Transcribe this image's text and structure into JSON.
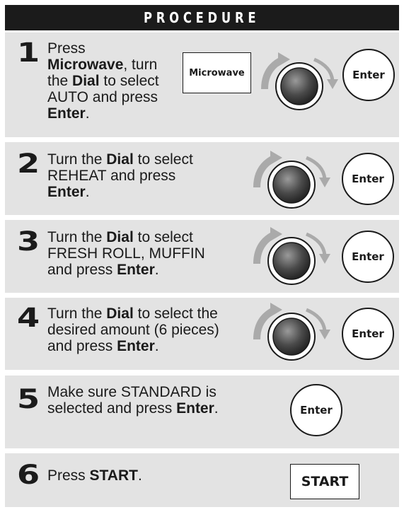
{
  "header": {
    "title": "PROCEDURE"
  },
  "colors": {
    "header_bg": "#1b1b1b",
    "step_bg": "#e3e3e3",
    "dial_arrow": "#aaaaaa"
  },
  "steps": [
    {
      "number": "1",
      "text": [
        {
          "t": "Press",
          "b": false,
          "br": true
        },
        {
          "t": "Microwave",
          "b": true
        },
        {
          "t": ", turn",
          "b": false,
          "br": true
        },
        {
          "t": "the ",
          "b": false
        },
        {
          "t": "Dial",
          "b": true
        },
        {
          "t": " to select",
          "b": false,
          "br": true
        },
        {
          "t": "AUTO and press",
          "b": false,
          "br": true
        },
        {
          "t": "Enter",
          "b": true
        },
        {
          "t": ".",
          "b": false
        }
      ],
      "key_label": "Microwave",
      "dial": true,
      "button_label": "Enter"
    },
    {
      "number": "2",
      "text": [
        {
          "t": "Turn the ",
          "b": false
        },
        {
          "t": "Dial",
          "b": true
        },
        {
          "t": " to select",
          "b": false,
          "br": true
        },
        {
          "t": "REHEAT and press",
          "b": false,
          "br": true
        },
        {
          "t": "Enter",
          "b": true
        },
        {
          "t": ".",
          "b": false
        }
      ],
      "dial": true,
      "button_label": "Enter"
    },
    {
      "number": "3",
      "text": [
        {
          "t": "Turn the ",
          "b": false
        },
        {
          "t": "Dial",
          "b": true
        },
        {
          "t": " to select",
          "b": false,
          "br": true
        },
        {
          "t": "FRESH ROLL, MUFFIN",
          "b": false,
          "br": true
        },
        {
          "t": "and press ",
          "b": false
        },
        {
          "t": "Enter",
          "b": true
        },
        {
          "t": ".",
          "b": false
        }
      ],
      "dial": true,
      "button_label": "Enter"
    },
    {
      "number": "4",
      "text": [
        {
          "t": "Turn the ",
          "b": false
        },
        {
          "t": "Dial",
          "b": true
        },
        {
          "t": " to select the",
          "b": false,
          "br": true
        },
        {
          "t": "desired amount (6 pieces)",
          "b": false,
          "br": true
        },
        {
          "t": "and press ",
          "b": false
        },
        {
          "t": "Enter",
          "b": true
        },
        {
          "t": ".",
          "b": false
        }
      ],
      "dial": true,
      "button_label": "Enter"
    },
    {
      "number": "5",
      "text": [
        {
          "t": "Make sure STANDARD is",
          "b": false,
          "br": true
        },
        {
          "t": "selected and press ",
          "b": false
        },
        {
          "t": "Enter",
          "b": true
        },
        {
          "t": ".",
          "b": false
        }
      ],
      "dial": false,
      "button_label": "Enter"
    },
    {
      "number": "6",
      "text": [
        {
          "t": "Press ",
          "b": false
        },
        {
          "t": "START",
          "b": true
        },
        {
          "t": ".",
          "b": false
        }
      ],
      "dial": false,
      "start_label": "START"
    }
  ]
}
